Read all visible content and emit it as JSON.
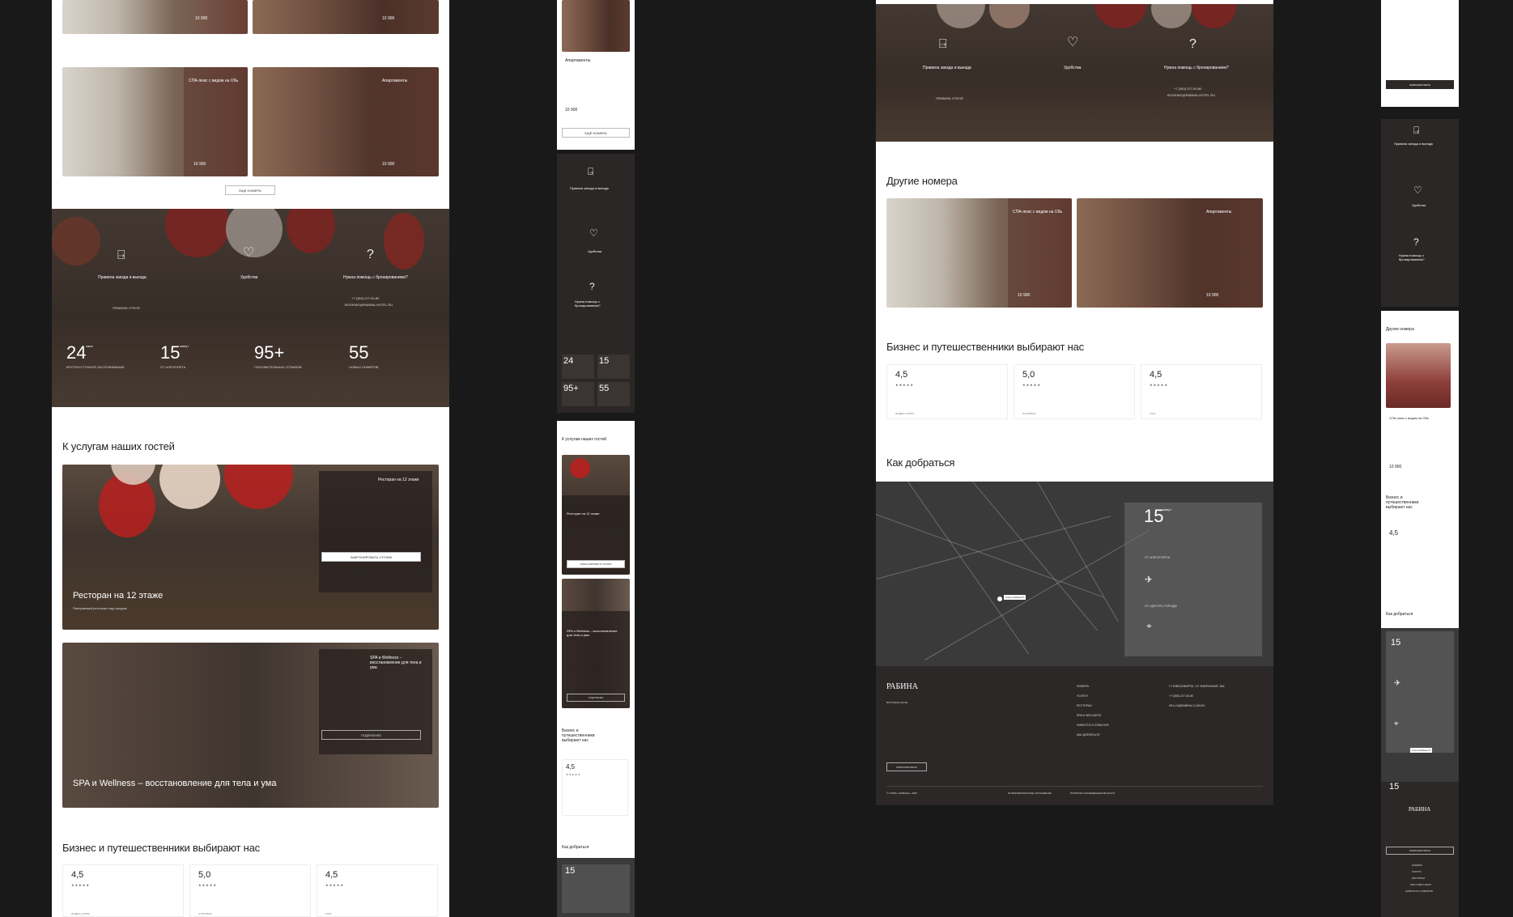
{
  "colors": {
    "background": "#191919",
    "accent_red": "#b8201f",
    "card_overlay": "#6b3b33",
    "dark_panel": "#2a2726"
  },
  "rooms": {
    "price_from": "от",
    "price_value": "10 900",
    "price_unit": "руб/ночь",
    "spa_room_title": "СПА-люкс с видом на Обь",
    "apartments_title": "Апартаменты",
    "more_rooms_button": "ЕЩЁ НОМЕРА"
  },
  "info": {
    "rules_title": "Правила заезда и выезда",
    "rules_link": "ПРАВИЛА ОТЕЛЯ",
    "amenities_title": "Удобства",
    "help_title": "Нужна помощь с бронированием?",
    "help_phone": "+7 (383) 227-00-80",
    "help_email": "BOOKING@RABINA-HOTEL.RU",
    "door_icon": "door-exit-icon",
    "hand_heart_icon": "hand-heart-icon",
    "question_icon": "question-circle-icon"
  },
  "stats": [
    {
      "value": "24",
      "sup": "часа",
      "label": "КРУГЛОСУТОЧНОЕ ОБСЛУЖИВАНИЕ"
    },
    {
      "value": "15",
      "sup": "минут",
      "label": "ОТ АЭРОПОРТА"
    },
    {
      "value": "95+",
      "sup": "",
      "label": "ПОЛОЖИТЕЛЬНЫХ ОТЗЫВОВ"
    },
    {
      "value": "55",
      "sup": "",
      "label": "НОВЫХ НОМЕРОВ"
    }
  ],
  "services": {
    "heading": "К услугам наших гостей",
    "restaurant_title": "Ресторан на 12 этаже",
    "restaurant_caption": "Ресторан на 12 этаже",
    "restaurant_subcaption": "Панорамный ресторан над городом",
    "restaurant_button": "ЗАБРОНИРОВАТЬ СТОЛИК",
    "spa_title": "SPA и Wellness – восстановление для тела и ума",
    "spa_caption": "SPA и Wellness – восстановление для тела и ума",
    "spa_button": "ПОДРОБНЕЕ"
  },
  "reviews": {
    "heading": "Бизнес и путешественники выбирают нас",
    "items": [
      {
        "score": "4,5",
        "source": "ЯНДЕКС КАРТЫ"
      },
      {
        "score": "5,0",
        "source": "ОСТРОВОК"
      },
      {
        "score": "4,5",
        "source": "2ГИС"
      }
    ],
    "stars": "★★★★★"
  },
  "other_rooms_heading": "Другие номера",
  "directions": {
    "heading": "Как добраться",
    "minutes": "15",
    "minutes_unit": "минут",
    "airport_label": "ОТ АЭРОПОРТА",
    "center_label": "ОТ ЦЕНТРА ГОРОДА",
    "map_pin_label": "Отель Рабина 4*",
    "plane_icon": "plane-icon",
    "pin_icon": "map-pin-icon"
  },
  "footer": {
    "logo": "РАБИНА",
    "logo_sub": "BOUTIQUE HOTEL",
    "nav": [
      "НОМЕРА",
      "УСЛУГИ",
      "РЕСТОРАН",
      "SPA И WELLNESS",
      "НОВОСТИ И СОБЫТИЯ",
      "КАК ДОБРАТЬСЯ"
    ],
    "address": "Г. НОВОСИБИРСК, УЛ. ФАБРИЧНАЯ, 26А",
    "phone": "+7 (383) 227-00-80",
    "email": "HELLO@RABINA-CLUB.RU",
    "book_button": "ЗАБРОНИРОВАТЬ",
    "copyright": "© ОТЕЛЬ «РАБИНА», 2025",
    "terms": "ПОЛЬЗОВАТЕЛЬСКОЕ СОГЛАШЕНИЕ",
    "privacy": "ПОЛИТИКА КОНФИДЕНЦИАЛЬНОСТИ"
  },
  "mobile": {
    "more_button": "ЕЩЁ НОМЕРА",
    "book_table": "ЗАБРОНИРОВАТЬ СТОЛИК",
    "details": "ПОДРОБНЕЕ",
    "book": "ЗАБРОНИРОВАТЬ"
  }
}
